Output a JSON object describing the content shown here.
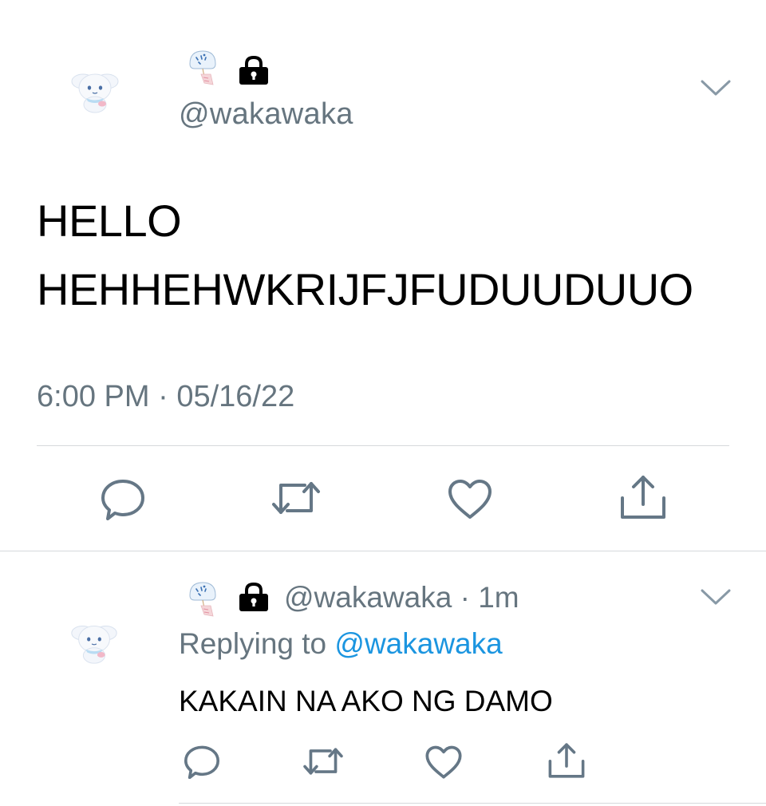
{
  "main_tweet": {
    "handle": "@wakawaka",
    "text_line1": "HELLO",
    "text_line2": "HEHHEHWKRIJFJFUDUUDUUO",
    "time": "6:00 PM",
    "separator": "·",
    "date": "05/16/22",
    "icons": {
      "avatar": "cinnamoroll-avatar",
      "name_emoji": "wind-chime-emoji",
      "lock": "lock-icon",
      "caret": "chevron-down-icon",
      "actions": [
        "reply-icon",
        "retweet-icon",
        "like-icon",
        "share-icon"
      ]
    }
  },
  "reply_tweet": {
    "handle": "@wakawaka",
    "separator": "·",
    "age": "1m",
    "replying_prefix": "Replying to",
    "replying_to": "@wakawaka",
    "text": "KAKAIN NA AKO NG DAMO"
  },
  "colors": {
    "secondary_text": "#66757f",
    "link": "#1b95e0",
    "divider": "#d6d9dc",
    "icon": "#657786"
  }
}
